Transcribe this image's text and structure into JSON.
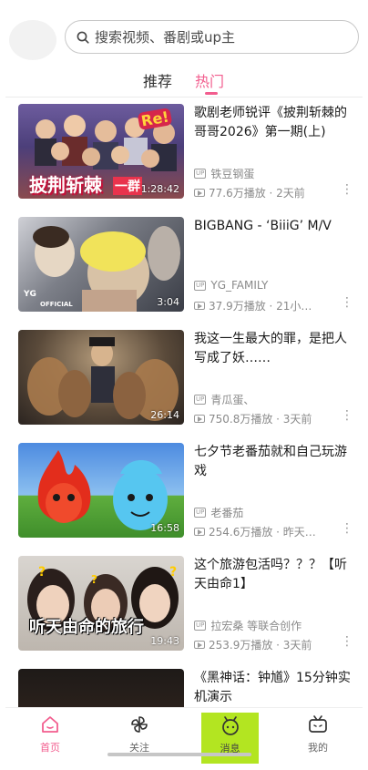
{
  "search": {
    "placeholder": "搜索视频、番剧或up主"
  },
  "tabs": [
    {
      "label": "推荐",
      "active": false
    },
    {
      "label": "热门",
      "active": true
    }
  ],
  "accent_color": "#f25d8e",
  "videos": [
    {
      "title": "歌剧老师锐评《披荆斩棘的哥哥2026》第一期(上)",
      "duration": "1:28:42",
      "uploader": "铁豆钢蛋",
      "views": "77.6万播放 · 2天前",
      "thumb_caption": "披荆斩棘",
      "thumb_caption2": "一群",
      "thumb_sticker": "Re!"
    },
    {
      "title": "BIGBANG - ‘BiiiG’ M/V",
      "duration": "3:04",
      "uploader": "YG_FAMILY",
      "views": "37.9万播放 · 21小…",
      "thumb_caption": "OFFICIAL",
      "thumb_logo": "YG"
    },
    {
      "title": "我这一生最大的罪，是把人写成了妖……",
      "duration": "26:14",
      "uploader": "青瓜蛋、",
      "views": "750.8万播放 · 3天前"
    },
    {
      "title": "七夕节老番茄就和自己玩游戏",
      "duration": "16:58",
      "uploader": "老番茄",
      "views": "254.6万播放 · 昨天…"
    },
    {
      "title": "这个旅游包活吗？？？【听天由命1】",
      "duration": "19:43",
      "uploader": "拉宏桑 等联合创作",
      "views": "253.9万播放 · 3天前",
      "thumb_caption": "听天由命的旅行"
    },
    {
      "title": "《黑神话：钟馗》15分钟实机演示",
      "duration": "",
      "uploader": "",
      "views": ""
    }
  ],
  "bottom_nav": [
    {
      "label": "首页",
      "icon": "home-icon",
      "active": true
    },
    {
      "label": "关注",
      "icon": "pinwheel-icon",
      "active": false
    },
    {
      "label": "消息",
      "icon": "message-icon",
      "active": false,
      "highlighted": true
    },
    {
      "label": "我的",
      "icon": "tv-icon",
      "active": false
    }
  ]
}
